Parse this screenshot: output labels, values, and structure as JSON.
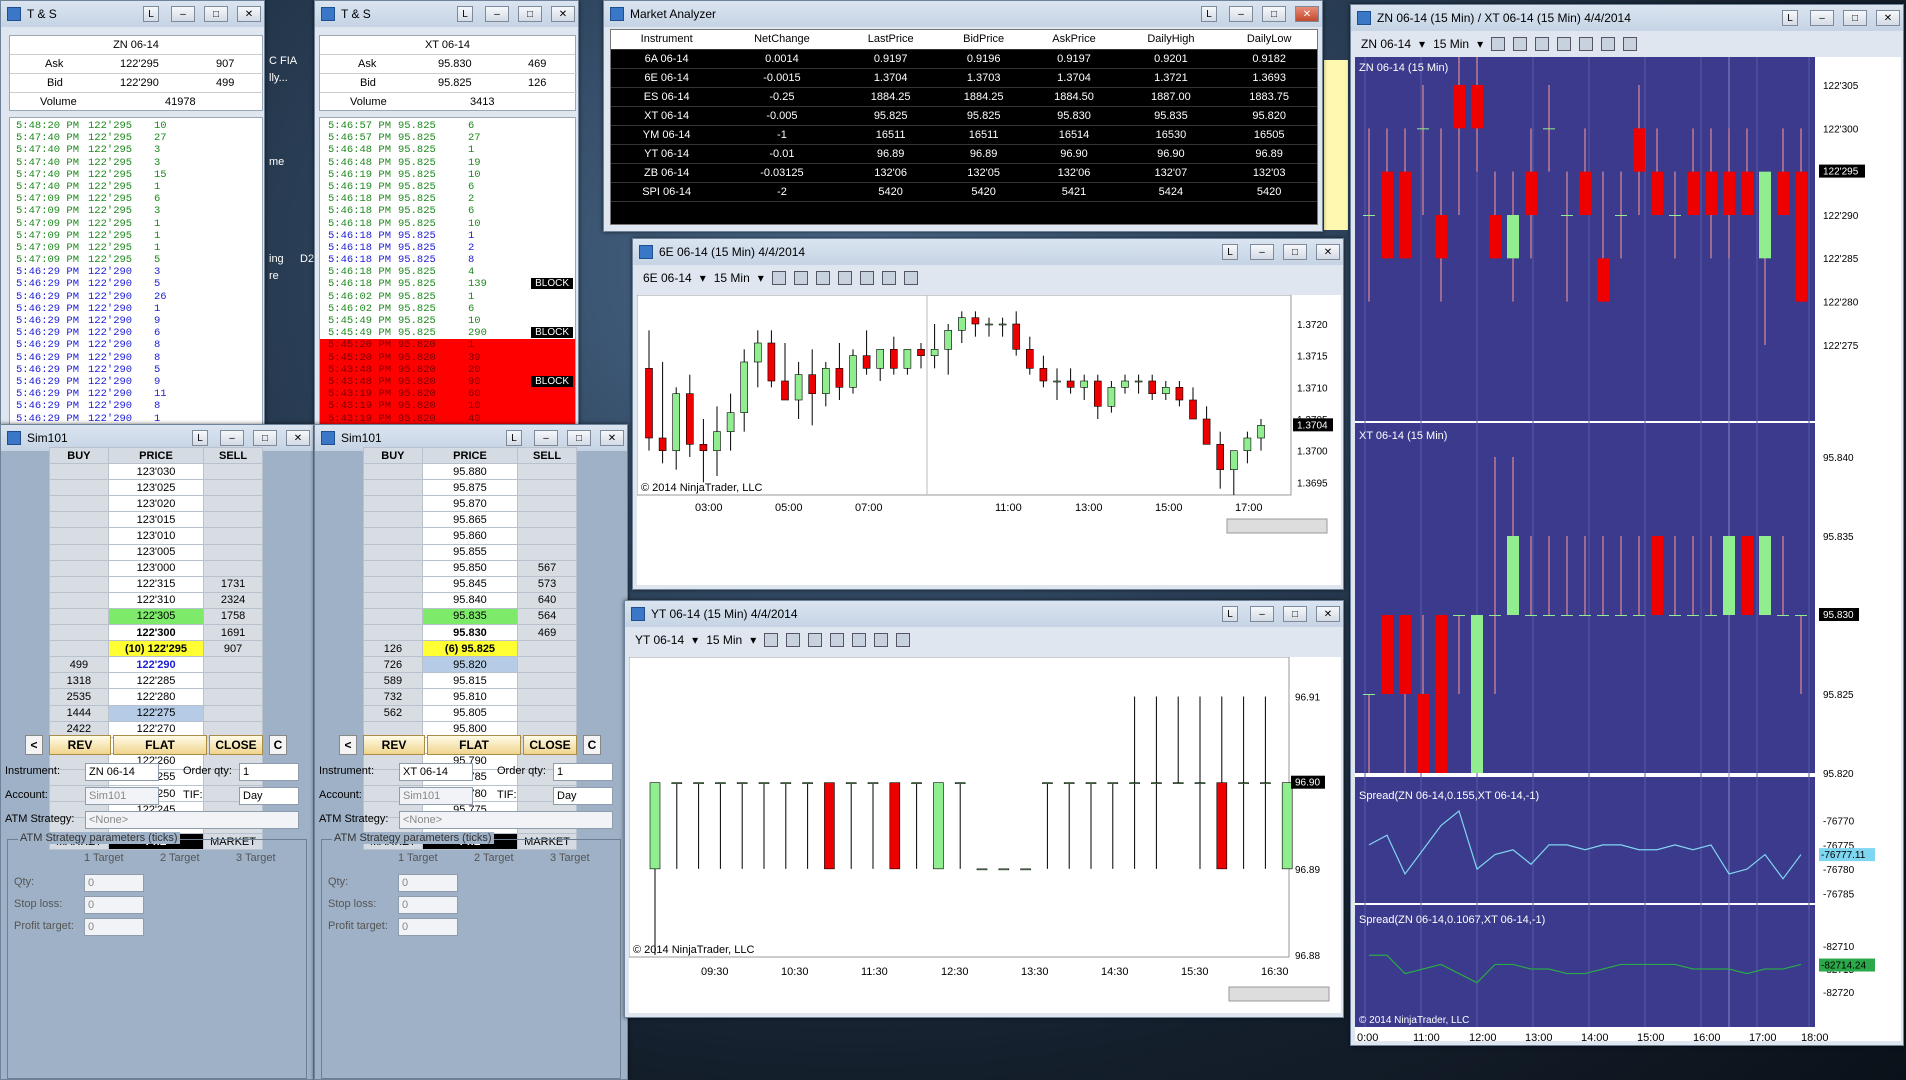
{
  "ts1": {
    "title": "T & S",
    "instrument": "ZN 06-14",
    "ask_label": "Ask",
    "ask_price": "122'295",
    "ask_size": "907",
    "bid_label": "Bid",
    "bid_price": "122'290",
    "bid_size": "499",
    "vol_label": "Volume",
    "volume": "41978",
    "rows": [
      [
        "5:48:20 PM",
        "122'295",
        "10",
        "g"
      ],
      [
        "5:47:40 PM",
        "122'295",
        "27",
        "g"
      ],
      [
        "5:47:40 PM",
        "122'295",
        "3",
        "g"
      ],
      [
        "5:47:40 PM",
        "122'295",
        "3",
        "g"
      ],
      [
        "5:47:40 PM",
        "122'295",
        "15",
        "g"
      ],
      [
        "5:47:40 PM",
        "122'295",
        "1",
        "g"
      ],
      [
        "5:47:09 PM",
        "122'295",
        "6",
        "g"
      ],
      [
        "5:47:09 PM",
        "122'295",
        "3",
        "g"
      ],
      [
        "5:47:09 PM",
        "122'295",
        "1",
        "g"
      ],
      [
        "5:47:09 PM",
        "122'295",
        "1",
        "g"
      ],
      [
        "5:47:09 PM",
        "122'295",
        "1",
        "g"
      ],
      [
        "5:47:09 PM",
        "122'295",
        "5",
        "g"
      ],
      [
        "5:46:29 PM",
        "122'290",
        "3",
        "b"
      ],
      [
        "5:46:29 PM",
        "122'290",
        "5",
        "b"
      ],
      [
        "5:46:29 PM",
        "122'290",
        "26",
        "b"
      ],
      [
        "5:46:29 PM",
        "122'290",
        "1",
        "b"
      ],
      [
        "5:46:29 PM",
        "122'290",
        "9",
        "b"
      ],
      [
        "5:46:29 PM",
        "122'290",
        "6",
        "b"
      ],
      [
        "5:46:29 PM",
        "122'290",
        "8",
        "b"
      ],
      [
        "5:46:29 PM",
        "122'290",
        "8",
        "b"
      ],
      [
        "5:46:29 PM",
        "122'290",
        "5",
        "b"
      ],
      [
        "5:46:29 PM",
        "122'290",
        "9",
        "b"
      ],
      [
        "5:46:29 PM",
        "122'290",
        "11",
        "b"
      ],
      [
        "5:46:29 PM",
        "122'290",
        "8",
        "b"
      ],
      [
        "5:46:29 PM",
        "122'290",
        "1",
        "b"
      ]
    ]
  },
  "ts2": {
    "title": "T & S",
    "instrument": "XT 06-14",
    "ask_label": "Ask",
    "ask_price": "95.830",
    "ask_size": "469",
    "bid_label": "Bid",
    "bid_price": "95.825",
    "bid_size": "126",
    "vol_label": "Volume",
    "volume": "3413",
    "rows": [
      [
        "5:46:57 PM",
        "95.825",
        "6",
        "g",
        ""
      ],
      [
        "5:46:57 PM",
        "95.825",
        "27",
        "g",
        ""
      ],
      [
        "5:46:48 PM",
        "95.825",
        "1",
        "g",
        ""
      ],
      [
        "5:46:48 PM",
        "95.825",
        "19",
        "g",
        ""
      ],
      [
        "5:46:19 PM",
        "95.825",
        "10",
        "g",
        ""
      ],
      [
        "5:46:19 PM",
        "95.825",
        "6",
        "g",
        ""
      ],
      [
        "5:46:18 PM",
        "95.825",
        "2",
        "g",
        ""
      ],
      [
        "5:46:18 PM",
        "95.825",
        "6",
        "g",
        ""
      ],
      [
        "5:46:18 PM",
        "95.825",
        "10",
        "g",
        ""
      ],
      [
        "5:46:18 PM",
        "95.825",
        "1",
        "b",
        ""
      ],
      [
        "5:46:18 PM",
        "95.825",
        "2",
        "b",
        ""
      ],
      [
        "5:46:18 PM",
        "95.825",
        "8",
        "b",
        ""
      ],
      [
        "5:46:18 PM",
        "95.825",
        "4",
        "g",
        ""
      ],
      [
        "5:46:18 PM",
        "95.825",
        "139",
        "g",
        "BLOCK"
      ],
      [
        "5:46:02 PM",
        "95.825",
        "1",
        "g",
        ""
      ],
      [
        "5:46:02 PM",
        "95.825",
        "6",
        "g",
        ""
      ],
      [
        "5:45:49 PM",
        "95.825",
        "10",
        "g",
        ""
      ],
      [
        "5:45:49 PM",
        "95.825",
        "290",
        "g",
        "BLOCK"
      ],
      [
        "5:45:20 PM",
        "95.820",
        "1",
        "r",
        ""
      ],
      [
        "5:45:20 PM",
        "95.820",
        "39",
        "r",
        ""
      ],
      [
        "5:43:48 PM",
        "95.820",
        "20",
        "r",
        ""
      ],
      [
        "5:43:48 PM",
        "95.820",
        "90",
        "r",
        "BLOCK"
      ],
      [
        "5:43:19 PM",
        "95.820",
        "60",
        "r",
        ""
      ],
      [
        "5:43:19 PM",
        "95.820",
        "10",
        "r",
        ""
      ],
      [
        "5:43:19 PM",
        "95.820",
        "40",
        "r",
        ""
      ]
    ]
  },
  "dom1": {
    "title": "Sim101",
    "h_buy": "BUY",
    "h_price": "PRICE",
    "h_sell": "SELL",
    "rows": [
      [
        "",
        "123'030",
        ""
      ],
      [
        "",
        "123'025",
        ""
      ],
      [
        "",
        "123'020",
        ""
      ],
      [
        "",
        "123'015",
        ""
      ],
      [
        "",
        "123'010",
        ""
      ],
      [
        "",
        "123'005",
        ""
      ],
      [
        "",
        "123'000",
        ""
      ],
      [
        "",
        "122'315",
        "1731"
      ],
      [
        "",
        "122'310",
        "2324"
      ],
      [
        "",
        "122'305",
        "1758"
      ],
      [
        "",
        "122'300",
        "1691"
      ],
      [
        "",
        "(10) 122'295",
        "907"
      ],
      [
        "499",
        "122'290",
        ""
      ],
      [
        "1318",
        "122'285",
        ""
      ],
      [
        "2535",
        "122'280",
        ""
      ],
      [
        "1444",
        "122'275",
        ""
      ],
      [
        "2422",
        "122'270",
        ""
      ],
      [
        "",
        "122'265",
        ""
      ],
      [
        "",
        "122'260",
        ""
      ],
      [
        "",
        "122'255",
        ""
      ],
      [
        "",
        "122'250",
        ""
      ],
      [
        "",
        "122'245",
        ""
      ],
      [
        "",
        "122'240",
        ""
      ]
    ],
    "market_l": "MARKET",
    "pnl": "PnL",
    "market_r": "MARKET",
    "lt": "<",
    "rev": "REV",
    "flat": "FLAT",
    "close": "CLOSE",
    "c": "C",
    "instrument_label": "Instrument:",
    "instrument": "ZN 06-14",
    "order_qty_label": "Order qty:",
    "order_qty": "1",
    "account_label": "Account:",
    "account": "Sim101",
    "tif_label": "TIF:",
    "tif": "Day",
    "atm_label": "ATM Strategy:",
    "atm": "<None>",
    "atm_params": "ATM Strategy parameters (ticks)",
    "t1": "1 Target",
    "t2": "2 Target",
    "t3": "3 Target",
    "qty_label": "Qty:",
    "qty": "0",
    "stop_label": "Stop loss:",
    "stop": "0",
    "profit_label": "Profit target:",
    "profit": "0"
  },
  "dom2": {
    "title": "Sim101",
    "h_buy": "BUY",
    "h_price": "PRICE",
    "h_sell": "SELL",
    "rows": [
      [
        "",
        "95.880",
        ""
      ],
      [
        "",
        "95.875",
        ""
      ],
      [
        "",
        "95.870",
        ""
      ],
      [
        "",
        "95.865",
        ""
      ],
      [
        "",
        "95.860",
        ""
      ],
      [
        "",
        "95.855",
        ""
      ],
      [
        "",
        "95.850",
        "567"
      ],
      [
        "",
        "95.845",
        "573"
      ],
      [
        "",
        "95.840",
        "640"
      ],
      [
        "",
        "95.835",
        "564"
      ],
      [
        "",
        "95.830",
        "469"
      ],
      [
        "126",
        "(6) 95.825",
        ""
      ],
      [
        "726",
        "95.820",
        ""
      ],
      [
        "589",
        "95.815",
        ""
      ],
      [
        "732",
        "95.810",
        ""
      ],
      [
        "562",
        "95.805",
        ""
      ],
      [
        "",
        "95.800",
        ""
      ],
      [
        "",
        "95.795",
        ""
      ],
      [
        "",
        "95.790",
        ""
      ],
      [
        "",
        "95.785",
        ""
      ],
      [
        "",
        "95.780",
        ""
      ],
      [
        "",
        "95.775",
        ""
      ],
      [
        "",
        "95.770",
        ""
      ]
    ],
    "market_l": "MARKET",
    "pnl": "PnL",
    "market_r": "MARKET",
    "lt": "<",
    "rev": "REV",
    "flat": "FLAT",
    "close": "CLOSE",
    "c": "C",
    "instrument_label": "Instrument:",
    "instrument": "XT 06-14",
    "order_qty_label": "Order qty:",
    "order_qty": "1",
    "account_label": "Account:",
    "account": "Sim101",
    "tif_label": "TIF:",
    "tif": "Day",
    "atm_label": "ATM Strategy:",
    "atm": "<None>",
    "atm_params": "ATM Strategy parameters (ticks)",
    "t1": "1 Target",
    "t2": "2 Target",
    "t3": "3 Target",
    "qty_label": "Qty:",
    "qty": "0",
    "stop_label": "Stop loss:",
    "stop": "0",
    "profit_label": "Profit target:",
    "profit": "0"
  },
  "ma": {
    "title": "Market Analyzer",
    "headers": [
      "Instrument",
      "NetChange",
      "LastPrice",
      "BidPrice",
      "AskPrice",
      "DailyHigh",
      "DailyLow"
    ],
    "rows": [
      [
        "6A 06-14",
        "0.0014",
        "0.9197",
        "0.9196",
        "0.9197",
        "0.9201",
        "0.9182"
      ],
      [
        "6E 06-14",
        "-0.0015",
        "1.3704",
        "1.3703",
        "1.3704",
        "1.3721",
        "1.3693"
      ],
      [
        "ES 06-14",
        "-0.25",
        "1884.25",
        "1884.25",
        "1884.50",
        "1887.00",
        "1883.75"
      ],
      [
        "XT 06-14",
        "-0.005",
        "95.825",
        "95.825",
        "95.830",
        "95.835",
        "95.820"
      ],
      [
        "YM 06-14",
        "-1",
        "16511",
        "16511",
        "16514",
        "16530",
        "16505"
      ],
      [
        "YT 06-14",
        "-0.01",
        "96.89",
        "96.89",
        "96.90",
        "96.90",
        "96.89"
      ],
      [
        "ZB 06-14",
        "-0.03125",
        "132'06",
        "132'05",
        "132'06",
        "132'07",
        "132'03"
      ],
      [
        "SPI 06-14",
        "-2",
        "5420",
        "5420",
        "5421",
        "5424",
        "5420"
      ]
    ]
  },
  "c6e": {
    "title": "6E 06-14 (15 Min)  4/4/2014",
    "instrument": "6E 06-14",
    "period": "15 Min",
    "copyright": "© 2014 NinjaTrader, LLC",
    "last": "1.3704",
    "yticks": [
      "1.3720",
      "1.3715",
      "1.3710",
      "1.3705",
      "1.3700",
      "1.3695"
    ],
    "xticks": [
      "03:00",
      "05:00",
      "07:00",
      "11:00",
      "13:00",
      "15:00",
      "17:00"
    ]
  },
  "cyt": {
    "title": "YT 06-14 (15 Min)  4/4/2014",
    "instrument": "YT 06-14",
    "period": "15 Min",
    "copyright": "© 2014 NinjaTrader, LLC",
    "last": "96.90",
    "yticks": [
      "96.91",
      "96.90",
      "96.89",
      "96.88"
    ],
    "xticks": [
      "09:30",
      "10:30",
      "11:30",
      "12:30",
      "13:30",
      "14:30",
      "15:30",
      "16:30"
    ]
  },
  "czn": {
    "title": "ZN 06-14 (15 Min) / XT 06-14 (15 Min)  4/4/2014",
    "instrument": "ZN 06-14",
    "period": "15 Min",
    "p1": "ZN 06-14 (15 Min)",
    "p2": "XT 06-14 (15 Min)",
    "p3": "Spread(ZN 06-14,0.155,XT 06-14,-1)",
    "p4": "Spread(ZN 06-14,0.1067,XT 06-14,-1)",
    "copyright": "© 2014 NinjaTrader, LLC",
    "y1": [
      "122'305",
      "122'300",
      "122'295",
      "122'290",
      "122'285",
      "122'280",
      "122'275"
    ],
    "last1": "122'295",
    "y2": [
      "95.840",
      "95.835",
      "95.830",
      "95.825",
      "95.820"
    ],
    "last2": "95.830",
    "y3": [
      "-76770",
      "-76775",
      "-76780",
      "-76785"
    ],
    "last3": "-76777.11",
    "y4": [
      "-82710",
      "-82715",
      "-82720"
    ],
    "last4": "-82714.24",
    "xticks": [
      "0:00",
      "11:00",
      "12:00",
      "13:00",
      "14:00",
      "15:00",
      "16:00",
      "17:00",
      "18:00"
    ]
  },
  "desktop": {
    "t1": "C FIA",
    "t2": "lly...",
    "t3": "me",
    "t4": "ing",
    "t5": "re",
    "t6": "D2"
  }
}
